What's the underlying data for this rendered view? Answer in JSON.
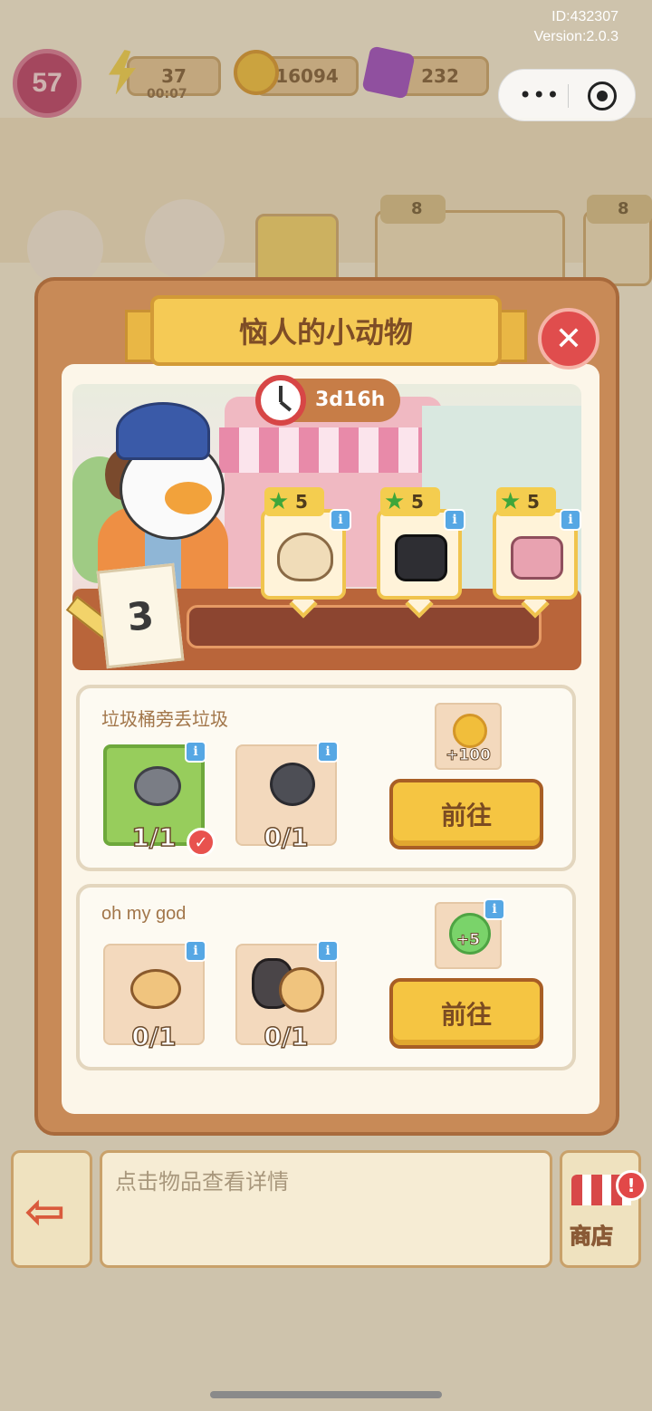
{
  "system": {
    "id_text": "ID:432307",
    "version_text": "Version:2.0.3"
  },
  "capsule": {
    "more_icon": "more-dots-icon",
    "close_icon": "target-circle-icon"
  },
  "hud": {
    "level": "57",
    "energy": "37",
    "energy_timer": "00:07",
    "coins": "16094",
    "gems": "232",
    "energy_color": "#f2d44c",
    "coin_color": "#f2c13b",
    "gem_color": "#9b47c9"
  },
  "background": {
    "cards": [
      {
        "stars": "8"
      },
      {
        "stars": "8"
      }
    ]
  },
  "modal": {
    "title": "恼人的小动物",
    "close_icon": "close-x-icon",
    "timer": "3d16h",
    "progress_count": "3",
    "orders": [
      {
        "stars": "5",
        "item": "beige-bag"
      },
      {
        "stars": "5",
        "item": "black-bag"
      },
      {
        "stars": "5",
        "item": "pink-bag"
      }
    ],
    "tasks": [
      {
        "title": "垃圾桶旁丢垃圾",
        "slots": [
          {
            "item": "snail-with-hamster",
            "count": "1/1",
            "done": true
          },
          {
            "item": "snail-with-cat",
            "count": "0/1",
            "done": false
          }
        ],
        "reward": "+100",
        "reward_icon": "gold-coin-icon",
        "button": "前往"
      },
      {
        "title": "oh my god",
        "slots": [
          {
            "item": "hamster",
            "count": "0/1",
            "done": false
          },
          {
            "item": "hamster-pair",
            "count": "0/1",
            "done": false
          }
        ],
        "reward": "+5",
        "reward_icon": "green-energy-orb-icon",
        "button": "前往"
      }
    ]
  },
  "bottom": {
    "exit_icon": "exit-door-arrow-icon",
    "detail_placeholder": "点击物品查看详情",
    "shop_label": "商店",
    "shop_alert": "!"
  }
}
